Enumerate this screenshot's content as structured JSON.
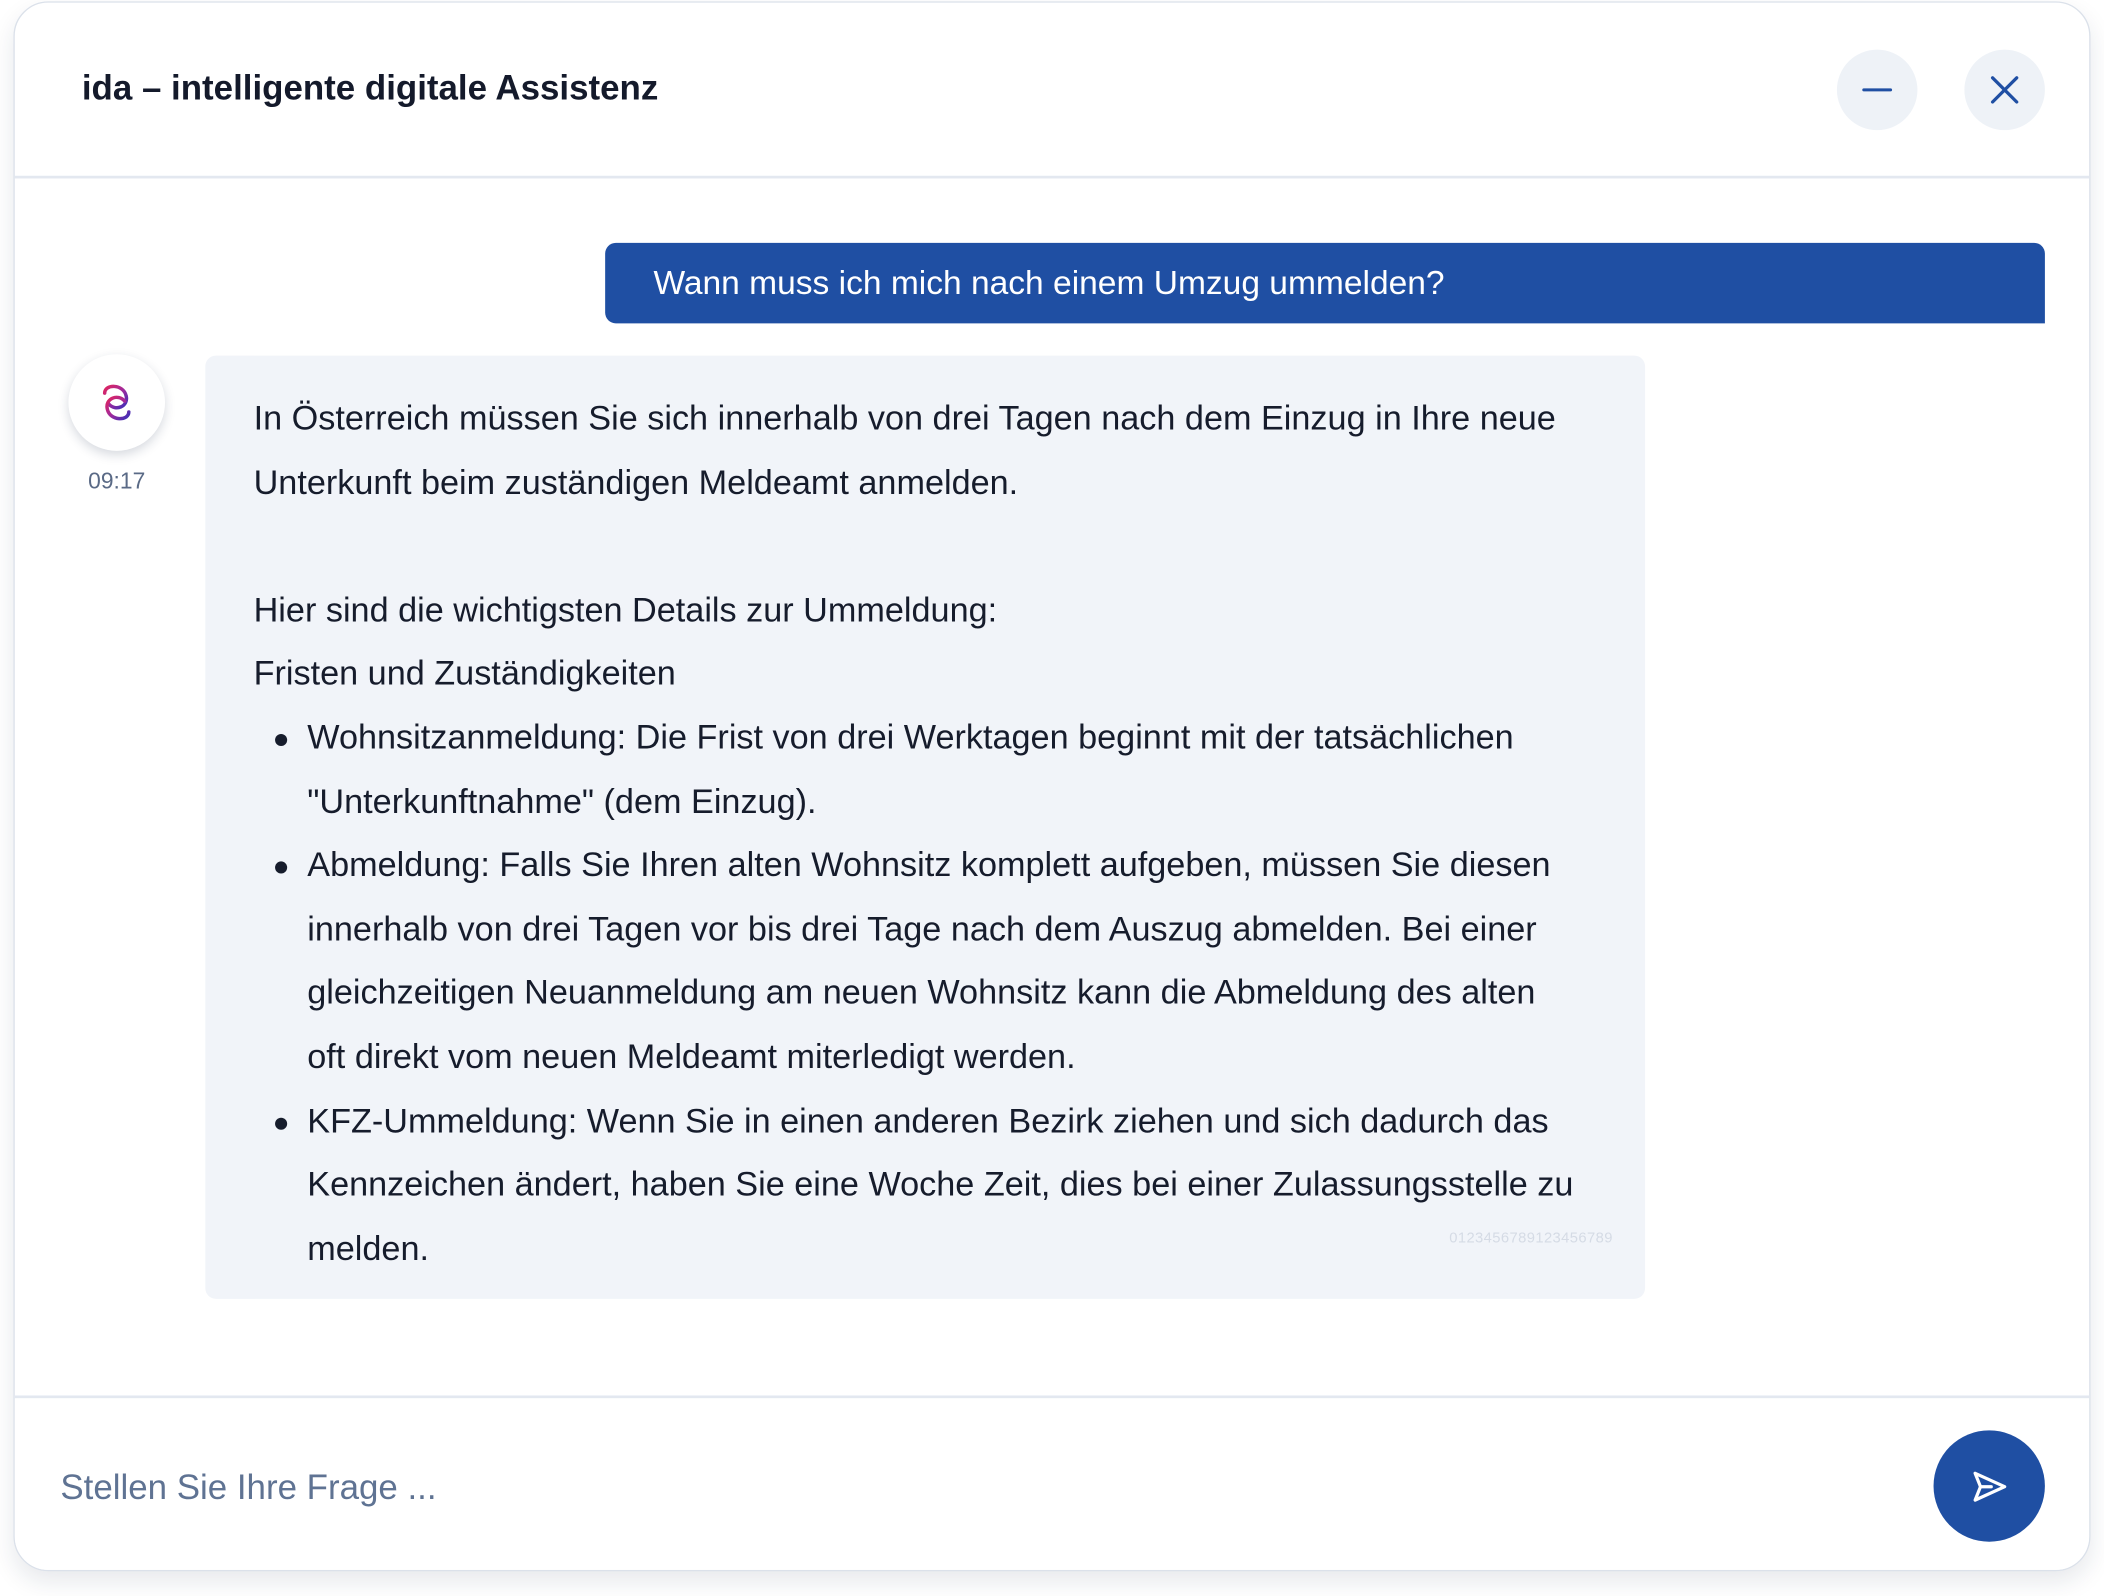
{
  "header": {
    "title": "ida – intelligente digitale Assistenz",
    "minimize_icon": "minus-icon",
    "close_icon": "close-icon"
  },
  "conversation": {
    "user_message": "Wann muss ich mich nach einem Umzug ummelden?",
    "assistant": {
      "avatar_icon": "ida-logo-icon",
      "time": "09:17",
      "intro_lines": [
        "In Österreich müssen Sie sich innerhalb von drei Tagen nach dem Einzug in Ihre neue",
        "Unterkunft beim zuständigen Meldeamt anmelden."
      ],
      "details_heading": "Hier sind die wichtigsten Details zur Ummeldung:",
      "section_heading": "Fristen und Zuständigkeiten",
      "bullets": [
        {
          "lines": [
            "Wohnsitzanmeldung: Die Frist von drei Werktagen beginnt mit der tatsächlichen",
            "\"Unterkunftnahme\" (dem Einzug)."
          ]
        },
        {
          "lines": [
            "Abmeldung: Falls Sie Ihren alten Wohnsitz komplett aufgeben, müssen Sie diesen",
            "innerhalb von drei Tagen vor bis drei Tage nach dem Auszug abmelden. Bei einer",
            "gleichzeitigen Neuanmeldung am neuen Wohnsitz kann die Abmeldung des alten",
            "oft direkt vom neuen Meldeamt miterledigt werden."
          ]
        },
        {
          "lines": [
            "KFZ-Ummeldung: Wenn Sie in einen anderen Bezirk ziehen und sich dadurch das",
            "Kennzeichen ändert, haben Sie eine Woche Zeit, dies bei einer Zulassungsstelle zu",
            "melden."
          ]
        }
      ],
      "watermark": "0123456789123456789"
    }
  },
  "composer": {
    "placeholder": "Stellen Sie Ihre Frage ...",
    "value": "",
    "send_icon": "send-icon"
  },
  "colors": {
    "primary": "#1f4fa3",
    "bubble_bg": "#f1f4f9",
    "header_button_bg": "#eef2f7"
  }
}
